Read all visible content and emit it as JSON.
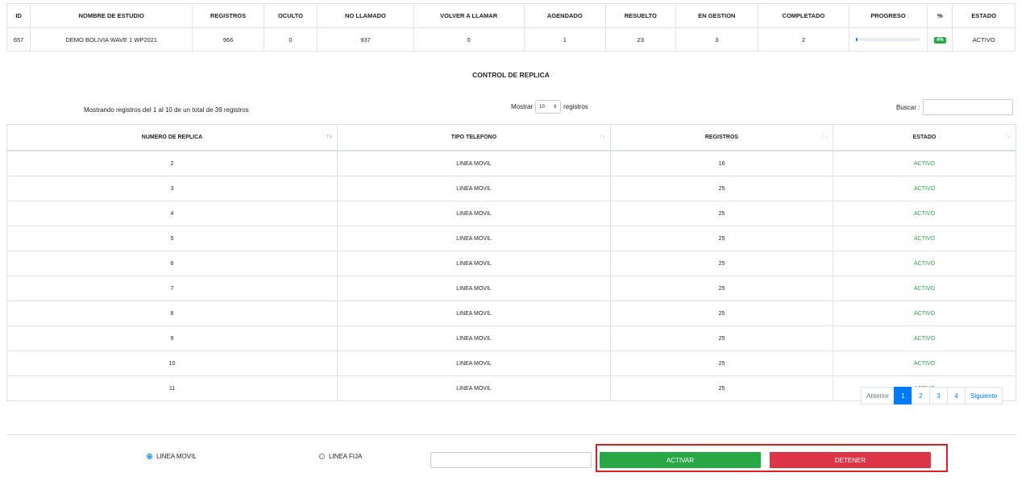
{
  "study_table": {
    "headers": [
      "ID",
      "NOMBRE DE ESTUDIO",
      "REGISTROS",
      "OCULTO",
      "NO LLAMADO",
      "VOLVER A LLAMAR",
      "AGENDADO",
      "RESUELTO",
      "EN GESTION",
      "COMPLETADO",
      "PROGRESO",
      "%",
      "ESTADO"
    ],
    "row": {
      "id": "657",
      "nombre": "DEMO BOLIVIA WAVE 1 WP2021",
      "registros": "966",
      "oculto": "0",
      "no_llamado": "937",
      "volver_a_llamar": "0",
      "agendado": "1",
      "resuelto": "23",
      "en_gestion": "3",
      "completado": "2",
      "progress_percent": 3,
      "percent_label": "4%",
      "estado": "ACTIVO"
    }
  },
  "section_title": "CONTROL DE REPLICA",
  "table_info": "Mostrando registros del 1 al 10 de un total de 39 registros",
  "length_control": {
    "prefix": "Mostrar",
    "value": "10",
    "suffix": "registros"
  },
  "search": {
    "label": "Buscar :",
    "value": ""
  },
  "replica_table": {
    "headers": [
      "NUMERO DE REPLICA",
      "TIPO TELEFONO",
      "REGISTROS",
      "ESTADO"
    ],
    "rows": [
      [
        "2",
        "LINEA MOVIL",
        "16",
        "ACTIVO"
      ],
      [
        "3",
        "LINEA MOVIL",
        "25",
        "ACTIVO"
      ],
      [
        "4",
        "LINEA MOVIL",
        "25",
        "ACTIVO"
      ],
      [
        "5",
        "LINEA MOVIL",
        "25",
        "ACTIVO"
      ],
      [
        "6",
        "LINEA MOVIL",
        "25",
        "ACTIVO"
      ],
      [
        "7",
        "LINEA MOVIL",
        "25",
        "ACTIVO"
      ],
      [
        "8",
        "LINEA MOVIL",
        "25",
        "ACTIVO"
      ],
      [
        "9",
        "LINEA MOVIL",
        "25",
        "ACTIVO"
      ],
      [
        "10",
        "LINEA MOVIL",
        "25",
        "ACTIVO"
      ],
      [
        "11",
        "LINEA MOVIL",
        "25",
        "ACTIVO"
      ]
    ]
  },
  "pagination": {
    "prev": "Anterior",
    "pages": [
      "1",
      "2",
      "3",
      "4"
    ],
    "current": "1",
    "next": "Siguiente"
  },
  "radio_options": [
    {
      "label": "LINEA MOVIL",
      "checked": true
    },
    {
      "label": "LINEA FIJA",
      "checked": false
    }
  ],
  "quantity_input_value": "",
  "buttons": {
    "activar": "ACTIVAR",
    "detener": "DETENER"
  },
  "colors": {
    "primary": "#007bff",
    "success": "#28a745",
    "danger": "#dc3545",
    "highlight_frame": "#dc1f1f"
  },
  "icons": {
    "sort_asc": "sort-asc-icon",
    "sort_neutral": "sort-icon",
    "select_arrows": "select-arrows-icon"
  }
}
